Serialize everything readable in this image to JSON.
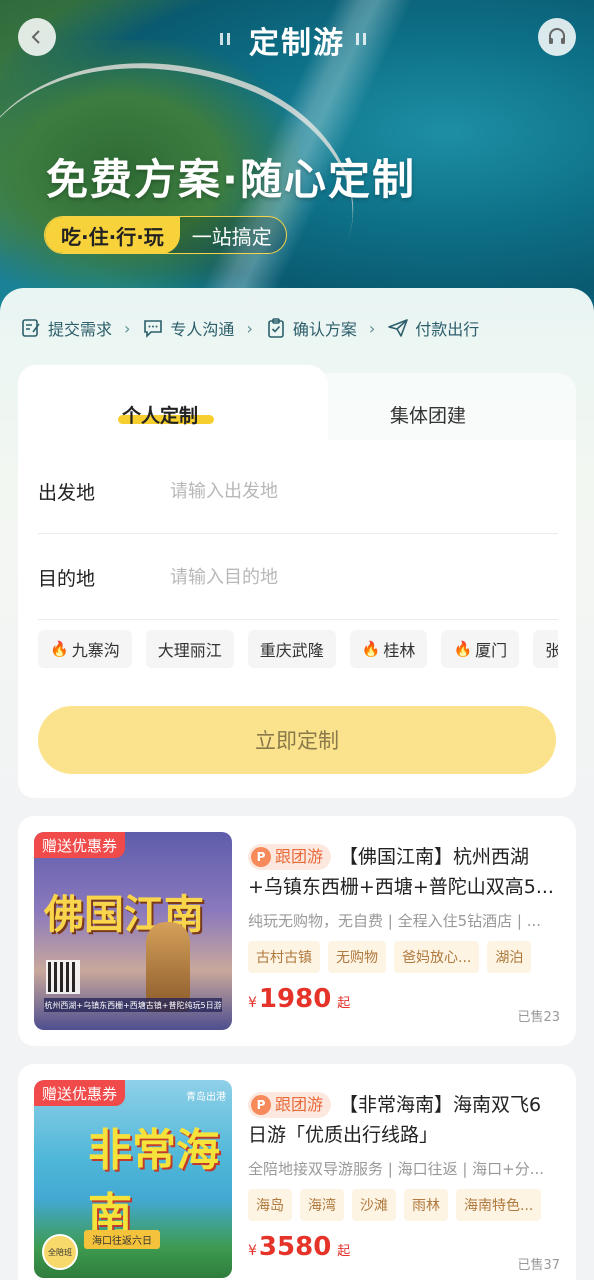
{
  "header": {
    "title": "定制游",
    "slogan": "免费方案·随心定制",
    "tag_highlight": "吃·住·行·玩",
    "tag_text": "一站搞定"
  },
  "steps": [
    {
      "label": "提交需求",
      "icon": "edit-form-icon"
    },
    {
      "label": "专人沟通",
      "icon": "chat-bubble-icon"
    },
    {
      "label": "确认方案",
      "icon": "clipboard-check-icon"
    },
    {
      "label": "付款出行",
      "icon": "paper-plane-icon"
    }
  ],
  "tabs": {
    "active": "个人定制",
    "inactive": "集体团建"
  },
  "form": {
    "origin_label": "出发地",
    "origin_placeholder": "请输入出发地",
    "dest_label": "目的地",
    "dest_placeholder": "请输入目的地",
    "chips": [
      {
        "label": "九寨沟",
        "hot": true
      },
      {
        "label": "大理丽江",
        "hot": false
      },
      {
        "label": "重庆武隆",
        "hot": false
      },
      {
        "label": "桂林",
        "hot": true
      },
      {
        "label": "厦门",
        "hot": true
      },
      {
        "label": "张",
        "hot": false
      }
    ],
    "submit_label": "立即定制"
  },
  "products": [
    {
      "coupon": "赠送优惠券",
      "thumb_text": "佛国江南",
      "thumb_strip": "杭州西湖+乌镇东西栅+西塘古镇+普陀纯玩5日游",
      "type_tag": "跟团游",
      "title": "【佛国江南】杭州西湖+乌镇东西栅+西塘+普陀山双高5...",
      "desc": "纯玩无购物，无自费 | 全程入住5钻酒店 | ...",
      "tags": [
        "古村古镇",
        "无购物",
        "爸妈放心...",
        "湖泊"
      ],
      "currency": "¥",
      "price": "1980",
      "price_suffix": "起",
      "sold": "已售23"
    },
    {
      "coupon": "赠送优惠券",
      "thumb_text": "非常海南",
      "thumb_sub": "海口往返六日",
      "thumb_corner": "青岛出港",
      "thumb_badge": "全陪班",
      "type_tag": "跟团游",
      "title": "【非常海南】海南双飞6日游「优质出行线路」",
      "desc": "全陪地接双导游服务 | 海口往返 | 海口+分...",
      "tags": [
        "海岛",
        "海湾",
        "沙滩",
        "雨林",
        "海南特色..."
      ],
      "currency": "¥",
      "price": "3580",
      "price_suffix": "起",
      "sold": "已售37"
    }
  ],
  "colors": {
    "accent_yellow": "#f6cf2e",
    "price_red": "#e5332a",
    "coupon_red": "#f04a4a",
    "tag_orange": "#e86a3a"
  }
}
